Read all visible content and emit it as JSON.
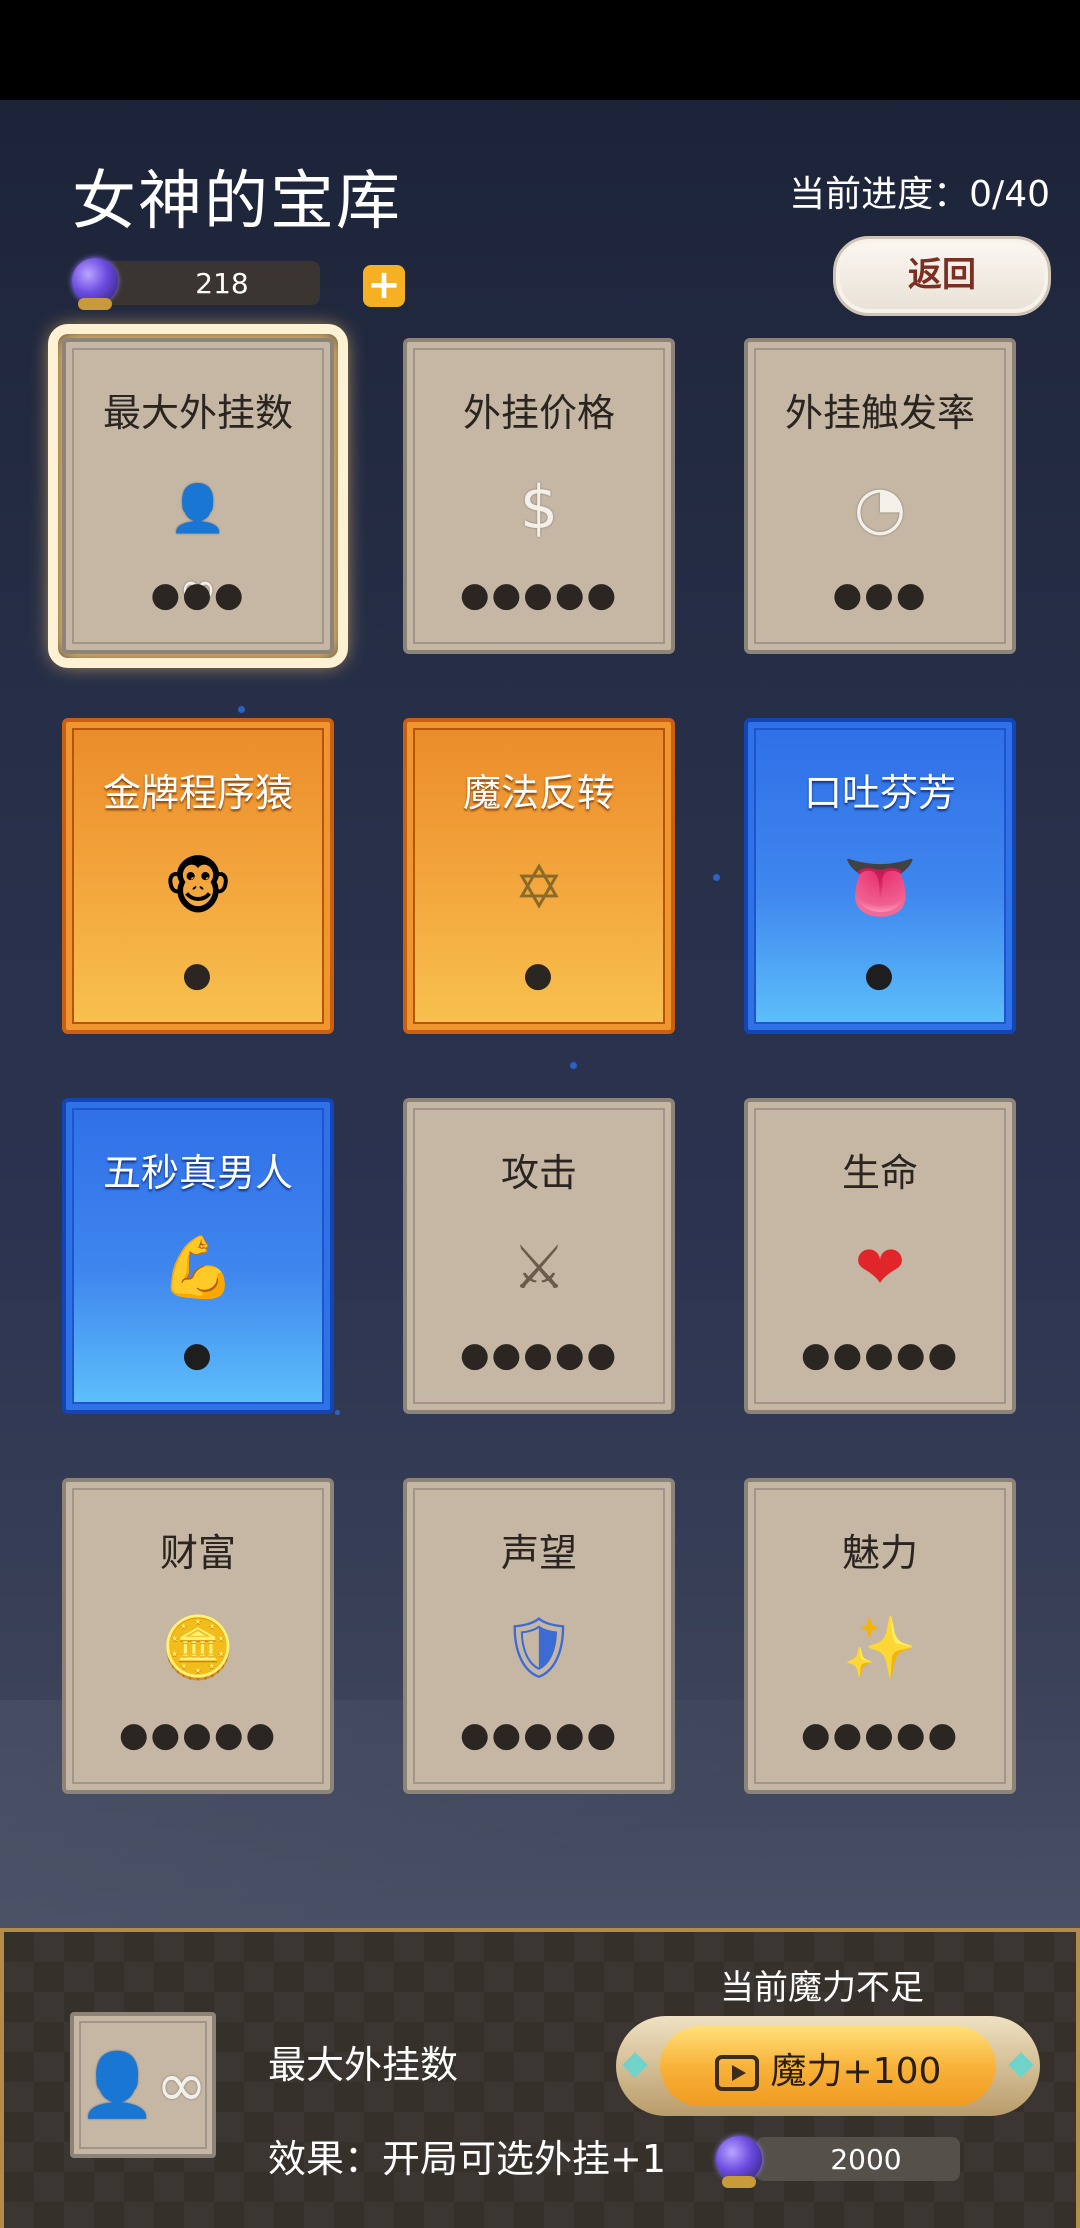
{
  "header": {
    "title": "女神的宝库",
    "progress": "当前进度：0/40",
    "currency_value": "218",
    "back_label": "返回"
  },
  "cards": [
    {
      "name": "最大外挂数",
      "style": "gray",
      "icon": "person-infinity-icon",
      "glyph": "👤∞",
      "dots": "●●●",
      "selected": true
    },
    {
      "name": "外挂价格",
      "style": "gray",
      "icon": "dollar-icon",
      "glyph": "$",
      "dots": "●●●●●",
      "selected": false
    },
    {
      "name": "外挂触发率",
      "style": "gray",
      "icon": "clock-icon",
      "glyph": "◔",
      "dots": "●●●",
      "selected": false
    },
    {
      "name": "金牌程序猿",
      "style": "orange",
      "icon": "monkey-icon",
      "glyph": "🐵",
      "dots": "●",
      "selected": false
    },
    {
      "name": "魔法反转",
      "style": "orange",
      "icon": "magic-star-icon",
      "glyph": "✡",
      "dots": "●",
      "selected": false
    },
    {
      "name": "口吐芬芳",
      "style": "blue",
      "icon": "tongue-icon",
      "glyph": "👅",
      "dots": "●",
      "selected": false
    },
    {
      "name": "五秒真男人",
      "style": "blue",
      "icon": "muscle-man-icon",
      "glyph": "💪",
      "dots": "●",
      "selected": false
    },
    {
      "name": "攻击",
      "style": "gray",
      "icon": "crossed-swords-icon",
      "glyph": "⚔",
      "dots": "●●●●●",
      "selected": false
    },
    {
      "name": "生命",
      "style": "gray",
      "icon": "heart-icon",
      "glyph": "❤",
      "dots": "●●●●●",
      "selected": false
    },
    {
      "name": "财富",
      "style": "gray",
      "icon": "coins-icon",
      "glyph": "🪙",
      "dots": "●●●●●",
      "selected": false
    },
    {
      "name": "声望",
      "style": "gray",
      "icon": "shield-badge-icon",
      "glyph": "🛡",
      "dots": "●●●●●",
      "selected": false
    },
    {
      "name": "魅力",
      "style": "gray",
      "icon": "sparkles-icon",
      "glyph": "✨",
      "dots": "●●●●●",
      "selected": false
    }
  ],
  "detail": {
    "name": "最大外挂数",
    "effect": "效果：开局可选外挂+1",
    "insufficient": "当前魔力不足",
    "mana_button": "魔力+100",
    "cost": "2000"
  },
  "colors": {
    "gray_card": "#c6b7a5",
    "orange_card": "#ef9630",
    "blue_card": "#3f86ee",
    "accent_gold": "#f5b123"
  }
}
